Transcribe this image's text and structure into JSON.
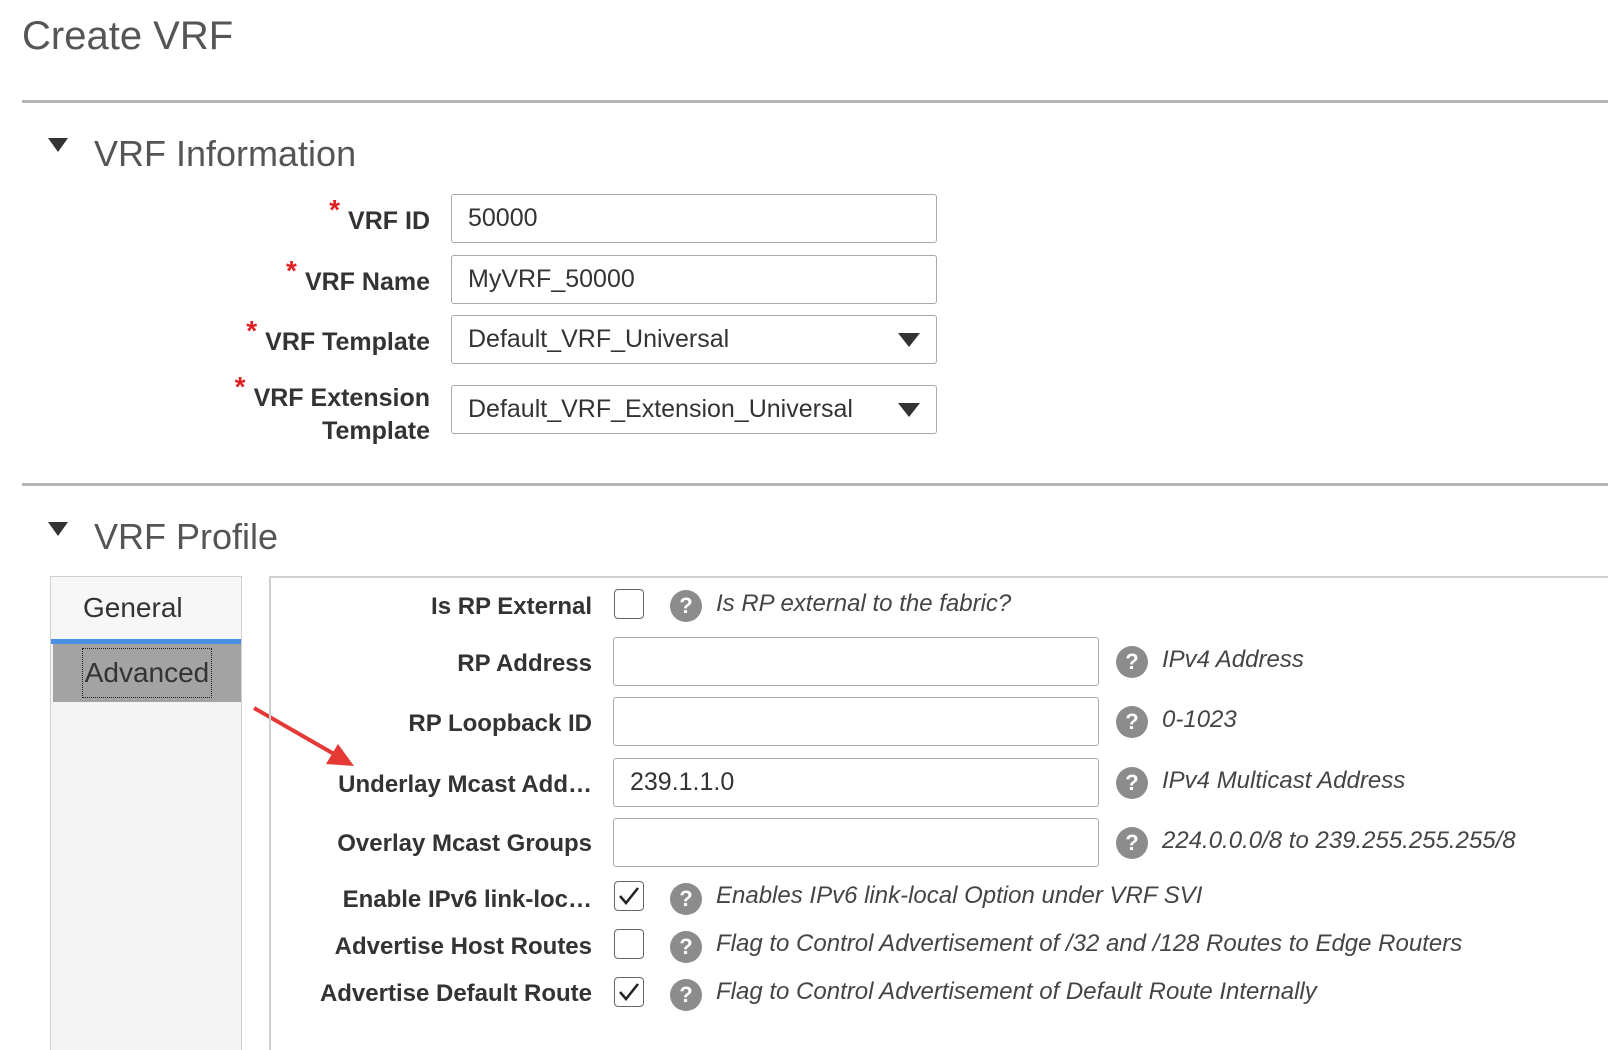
{
  "page": {
    "title": "Create VRF"
  },
  "vrf_information": {
    "title": "VRF Information",
    "vrf_id": {
      "label": "VRF ID",
      "value": "50000"
    },
    "vrf_name": {
      "label": "VRF Name",
      "value": "MyVRF_50000"
    },
    "vrf_template": {
      "label": "VRF Template",
      "value": "Default_VRF_Universal"
    },
    "vrf_extension_template": {
      "label_line1": "VRF Extension",
      "label_line2": "Template",
      "value": "Default_VRF_Extension_Universal"
    },
    "required_mark": "*"
  },
  "vrf_profile": {
    "title": "VRF Profile",
    "tabs": {
      "general": "General",
      "advanced": "Advanced"
    },
    "fields": {
      "is_rp_external": {
        "label": "Is RP External",
        "hint": "Is RP external to the fabric?",
        "checked": false
      },
      "rp_address": {
        "label": "RP Address",
        "hint": "IPv4 Address",
        "value": ""
      },
      "rp_loopback_id": {
        "label": "RP Loopback ID",
        "hint": "0-1023",
        "value": ""
      },
      "underlay_mcast": {
        "label": "Underlay Mcast Add…",
        "hint": "IPv4 Multicast Address",
        "value": "239.1.1.0"
      },
      "overlay_mcast": {
        "label": "Overlay Mcast Groups",
        "hint": "224.0.0.0/8 to 239.255.255.255/8",
        "value": ""
      },
      "enable_ipv6_link_local": {
        "label": "Enable IPv6 link-loc…",
        "hint": "Enables IPv6 link-local Option under VRF SVI",
        "checked": true
      },
      "advertise_host_routes": {
        "label": "Advertise Host Routes",
        "hint": "Flag to Control Advertisement of /32 and /128 Routes to Edge Routers",
        "checked": false
      },
      "advertise_default_route": {
        "label": "Advertise Default Route",
        "hint": "Flag to Control Advertisement of Default Route Internally",
        "checked": true
      }
    },
    "help_glyph": "?"
  },
  "colors": {
    "required": "#e02020",
    "tab_active_underline": "#4a90e2",
    "annotation_arrow": "#e53935"
  }
}
